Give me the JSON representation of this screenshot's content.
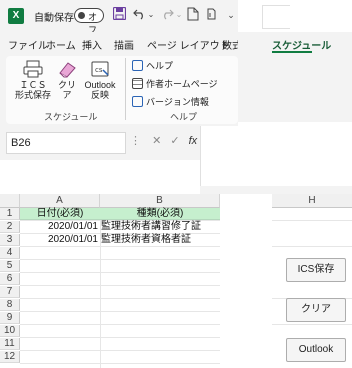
{
  "titlebar": {
    "app_icon": "X",
    "autosave_label": "自動保存",
    "autosave_toggle": "オフ",
    "overflow": "⌄"
  },
  "tabs": [
    {
      "label": "ファイル"
    },
    {
      "label": "ホーム"
    },
    {
      "label": "挿入"
    },
    {
      "label": "描画"
    },
    {
      "label": "ページ レイアウト"
    },
    {
      "label": "数式"
    },
    {
      "label": "スケジュール"
    }
  ],
  "ribbon": {
    "schedule_group": {
      "label": "スケジュール",
      "buttons": [
        {
          "label_line1": "ＩＣＳ",
          "label_line2": "形式保存",
          "icon": "printer-icon"
        },
        {
          "label_line1": "クリ",
          "label_line2": "ア",
          "icon": "eraser-icon"
        },
        {
          "label_line1": "Outlook",
          "label_line2": "反映",
          "icon": "calendar-icon"
        }
      ]
    },
    "help_group": {
      "label": "ヘルプ",
      "items": [
        {
          "label": "ヘルプ",
          "icon": "help-icon"
        },
        {
          "label": "作者ホームページ",
          "icon": "table-icon"
        },
        {
          "label": "バージョン情報",
          "icon": "info-icon"
        }
      ]
    }
  },
  "formula_bar": {
    "name_box": "B26",
    "cancel": "✕",
    "enter": "✓",
    "fx": "fx",
    "dots": "⋮"
  },
  "grid": {
    "columns": [
      "A",
      "B"
    ],
    "right_column": "H",
    "rows": [
      "1",
      "2",
      "3",
      "4",
      "5",
      "6",
      "7",
      "8",
      "9",
      "10",
      "11",
      "12"
    ],
    "header": {
      "a": "日付(必須)",
      "b": "種類(必須)"
    },
    "data": [
      {
        "a": "2020/01/01",
        "b": "監理技術者講習修了証"
      },
      {
        "a": "2020/01/01",
        "b": "監理技術者資格者証"
      }
    ],
    "header_fill": "#c6efce"
  },
  "sheet_buttons": [
    {
      "label": "ICS保存"
    },
    {
      "label": "クリア"
    },
    {
      "label": "Outlook"
    }
  ]
}
